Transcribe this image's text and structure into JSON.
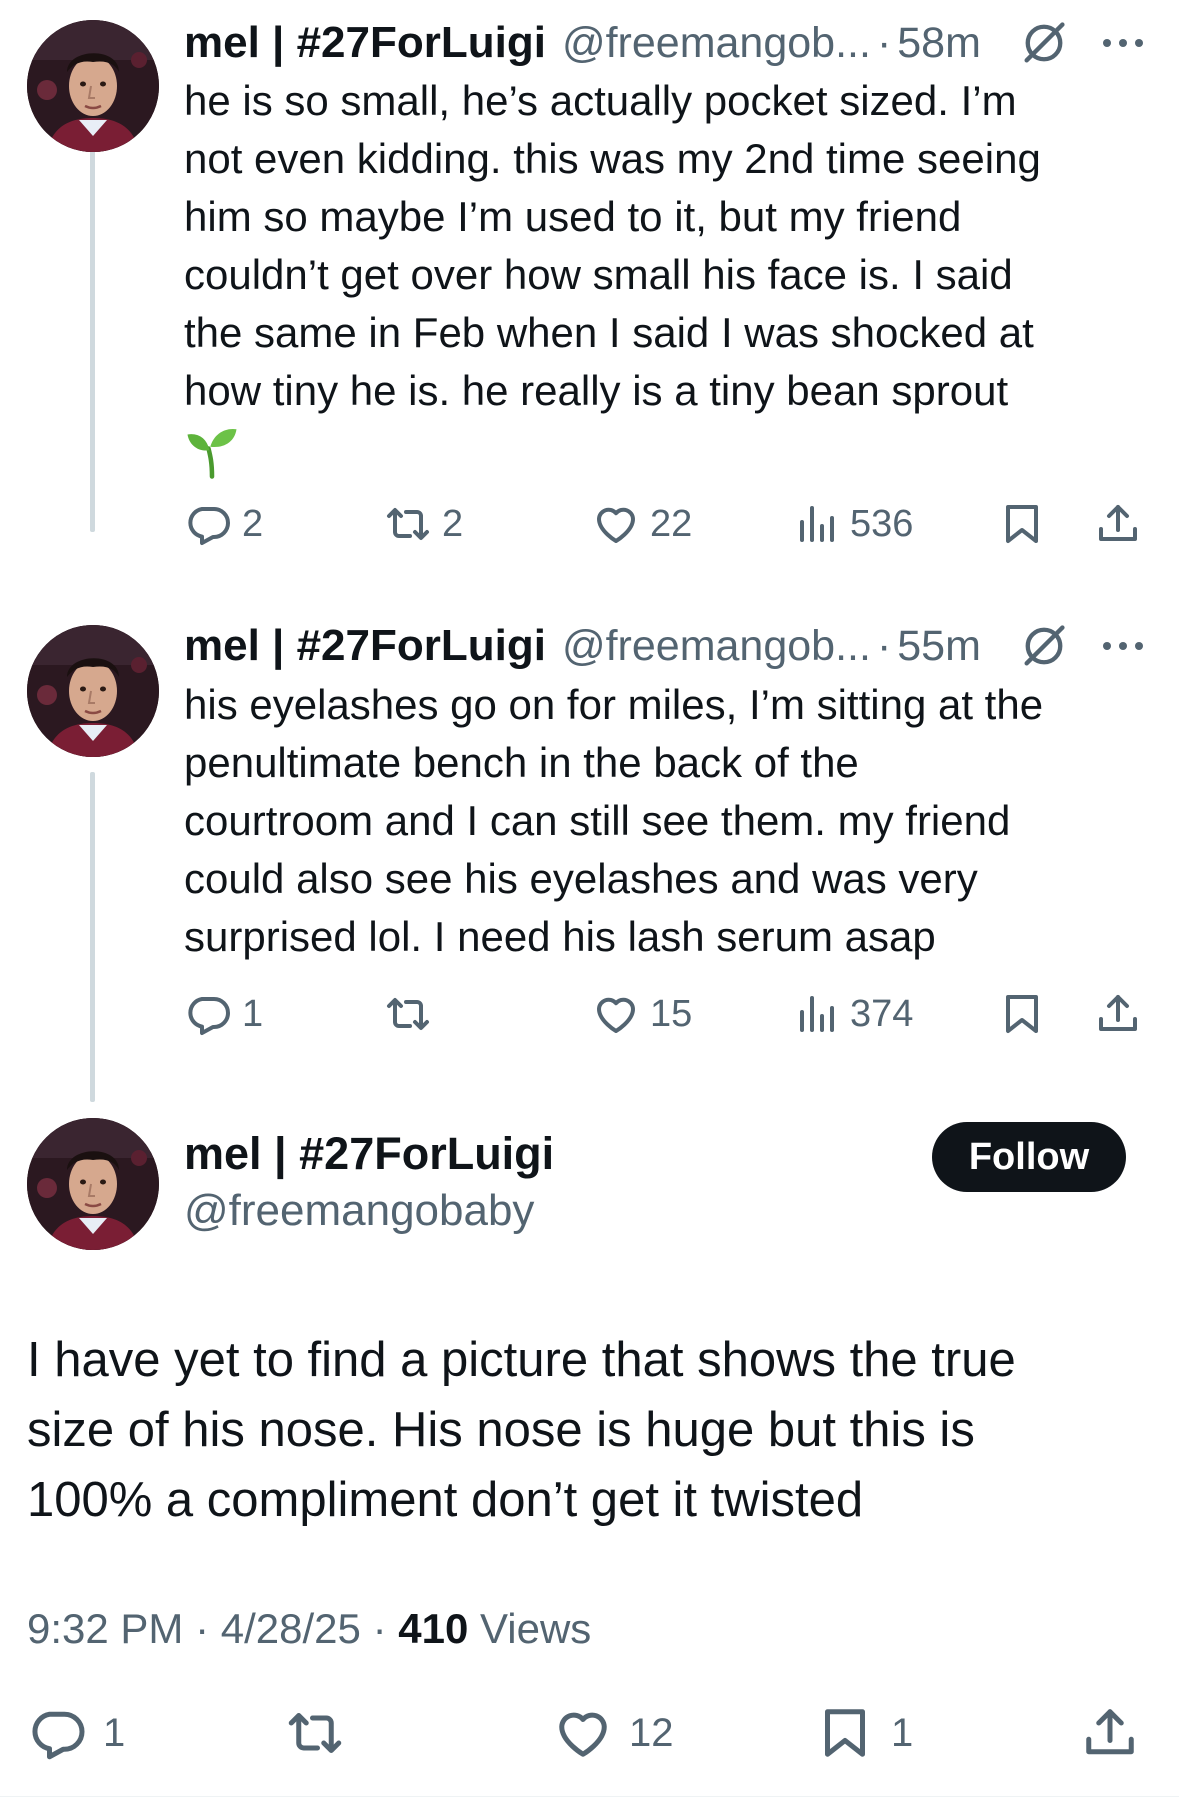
{
  "replies": [
    {
      "name": "mel | #27ForLuigi",
      "handle": "@freemangob...",
      "separator": "·",
      "time": "58m",
      "text": "he is so small, he’s actually pocket sized. I’m\nnot even kidding. this was my 2nd time seeing\nhim so maybe I’m used to it, but my friend\ncouldn’t get over how small his face is. I said\nthe same in Feb when I said I was shocked at\nhow tiny he is. he really is a tiny bean sprout",
      "emoji": "seedling-emoji",
      "replies": "2",
      "reposts": "2",
      "likes": "22",
      "views": "536"
    },
    {
      "name": "mel | #27ForLuigi",
      "handle": "@freemangob...",
      "separator": "·",
      "time": "55m",
      "text": "his eyelashes go on for miles, I’m sitting at the\npenultimate bench in the back of the\ncourtroom and I can still see them. my friend\ncould also see his eyelashes and was very\nsurprised lol. I need his lash serum asap",
      "replies": "1",
      "reposts": "",
      "likes": "15",
      "views": "374"
    }
  ],
  "main": {
    "name": "mel | #27ForLuigi",
    "handle": "@freemangobaby",
    "follow_label": "Follow",
    "text": "I have yet to find a picture that shows the true\nsize of his nose. His nose is huge but this is\n100% a compliment don’t get it twisted",
    "time": "9:32 PM",
    "dot": "·",
    "date": "4/28/25",
    "views_count": "410",
    "views_label": "Views",
    "replies": "1",
    "reposts": "",
    "likes": "12",
    "bookmarks": "1"
  },
  "icons": {
    "reply": "reply-icon",
    "repost": "repost-icon",
    "like": "heart-icon",
    "views": "views-icon",
    "bookmark": "bookmark-icon",
    "share": "share-icon",
    "grok": "grok-icon",
    "more": "more-icon"
  },
  "colors": {
    "text": "#0f1419",
    "secondary": "#536471",
    "thread_line": "#cfd9de",
    "follow_bg": "#0f1419",
    "seedling": "#5db33b"
  }
}
